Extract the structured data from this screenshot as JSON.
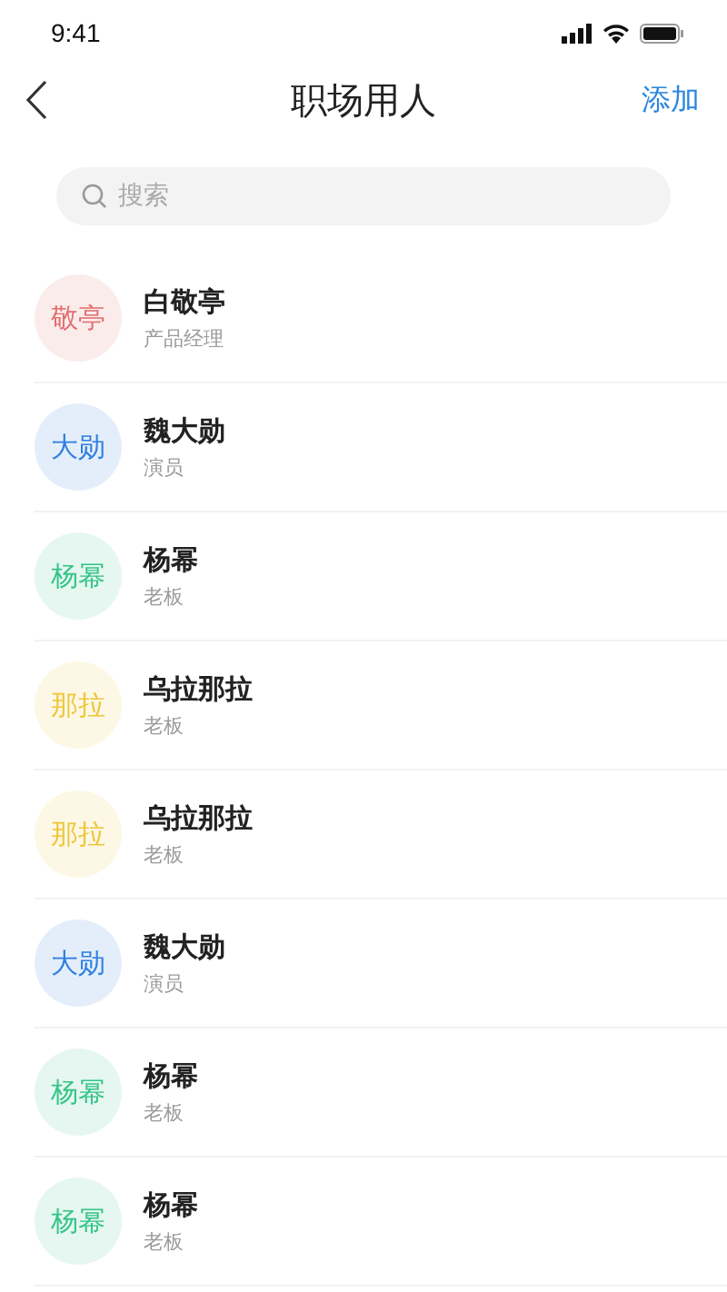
{
  "status_bar": {
    "time": "9:41"
  },
  "nav": {
    "title": "职场用人",
    "action": "添加"
  },
  "search": {
    "placeholder": "搜索"
  },
  "contacts": [
    {
      "avatar": "敬亭",
      "name": "白敬亭",
      "role": "产品经理",
      "color": "#e26d6d"
    },
    {
      "avatar": "大勋",
      "name": "魏大勋",
      "role": "演员",
      "color": "#2f7fe0"
    },
    {
      "avatar": "杨幂",
      "name": "杨幂",
      "role": "老板",
      "color": "#35c489"
    },
    {
      "avatar": "那拉",
      "name": "乌拉那拉",
      "role": "老板",
      "color": "#efc63a"
    },
    {
      "avatar": "那拉",
      "name": "乌拉那拉",
      "role": "老板",
      "color": "#efc63a"
    },
    {
      "avatar": "大勋",
      "name": "魏大勋",
      "role": "演员",
      "color": "#2f7fe0"
    },
    {
      "avatar": "杨幂",
      "name": "杨幂",
      "role": "老板",
      "color": "#35c489"
    },
    {
      "avatar": "杨幂",
      "name": "杨幂",
      "role": "老板",
      "color": "#35c489"
    }
  ]
}
